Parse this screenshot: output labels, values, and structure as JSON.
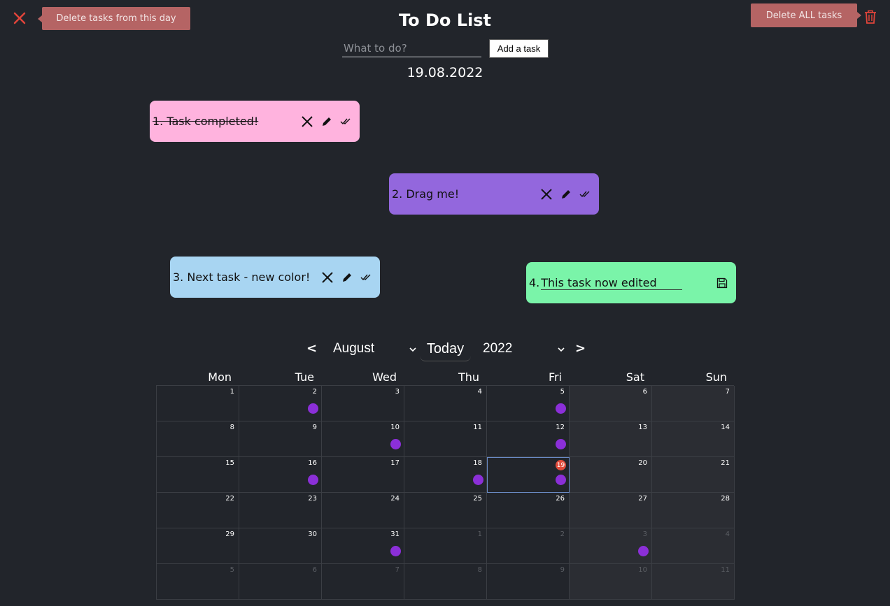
{
  "header": {
    "title": "To Do List",
    "delete_day_label": "Delete tasks from this day",
    "delete_all_label": "Delete ALL tasks"
  },
  "input": {
    "placeholder": "What to do?",
    "add_label": "Add a task"
  },
  "current_date": "19.08.2022",
  "tasks": [
    {
      "text": "1. Task completed!",
      "color": "#ffb3de",
      "completed": true
    },
    {
      "text": "2. Drag me!",
      "color": "#9367dd",
      "completed": false
    },
    {
      "text": "3. Next task - new color!",
      "color": "#a8d5f2",
      "completed": false
    },
    {
      "prefix": "4.",
      "edit_value": "This task now edited",
      "color": "#7af4a9",
      "editing": true
    }
  ],
  "calendar": {
    "prev": "<",
    "next": ">",
    "month": "August",
    "today_label": "Today",
    "year": "2022",
    "weekdays": [
      "Mon",
      "Tue",
      "Wed",
      "Thu",
      "Fri",
      "Sat",
      "Sun"
    ],
    "weeks": [
      [
        {
          "d": "1"
        },
        {
          "d": "2",
          "task": true
        },
        {
          "d": "3"
        },
        {
          "d": "4"
        },
        {
          "d": "5",
          "task": true
        },
        {
          "d": "6"
        },
        {
          "d": "7"
        }
      ],
      [
        {
          "d": "8"
        },
        {
          "d": "9"
        },
        {
          "d": "10",
          "task": true
        },
        {
          "d": "11"
        },
        {
          "d": "12",
          "task": true
        },
        {
          "d": "13"
        },
        {
          "d": "14"
        }
      ],
      [
        {
          "d": "15"
        },
        {
          "d": "16",
          "task": true
        },
        {
          "d": "17"
        },
        {
          "d": "18",
          "task": true
        },
        {
          "d": "19",
          "task": true,
          "today": true
        },
        {
          "d": "20"
        },
        {
          "d": "21"
        }
      ],
      [
        {
          "d": "22"
        },
        {
          "d": "23"
        },
        {
          "d": "24"
        },
        {
          "d": "25"
        },
        {
          "d": "26"
        },
        {
          "d": "27"
        },
        {
          "d": "28"
        }
      ],
      [
        {
          "d": "29"
        },
        {
          "d": "30"
        },
        {
          "d": "31",
          "task": true
        },
        {
          "d": "1",
          "other": true
        },
        {
          "d": "2",
          "other": true
        },
        {
          "d": "3",
          "other": true,
          "task": true
        },
        {
          "d": "4",
          "other": true
        }
      ],
      [
        {
          "d": "5",
          "other": true
        },
        {
          "d": "6",
          "other": true
        },
        {
          "d": "7",
          "other": true
        },
        {
          "d": "8",
          "other": true
        },
        {
          "d": "9",
          "other": true
        },
        {
          "d": "10",
          "other": true
        },
        {
          "d": "11",
          "other": true
        }
      ]
    ]
  },
  "colors": {
    "background": "#22252b",
    "delete_button": "#b56464",
    "task_dot": "#8b2fd8",
    "today_badge": "#e04c3c"
  }
}
